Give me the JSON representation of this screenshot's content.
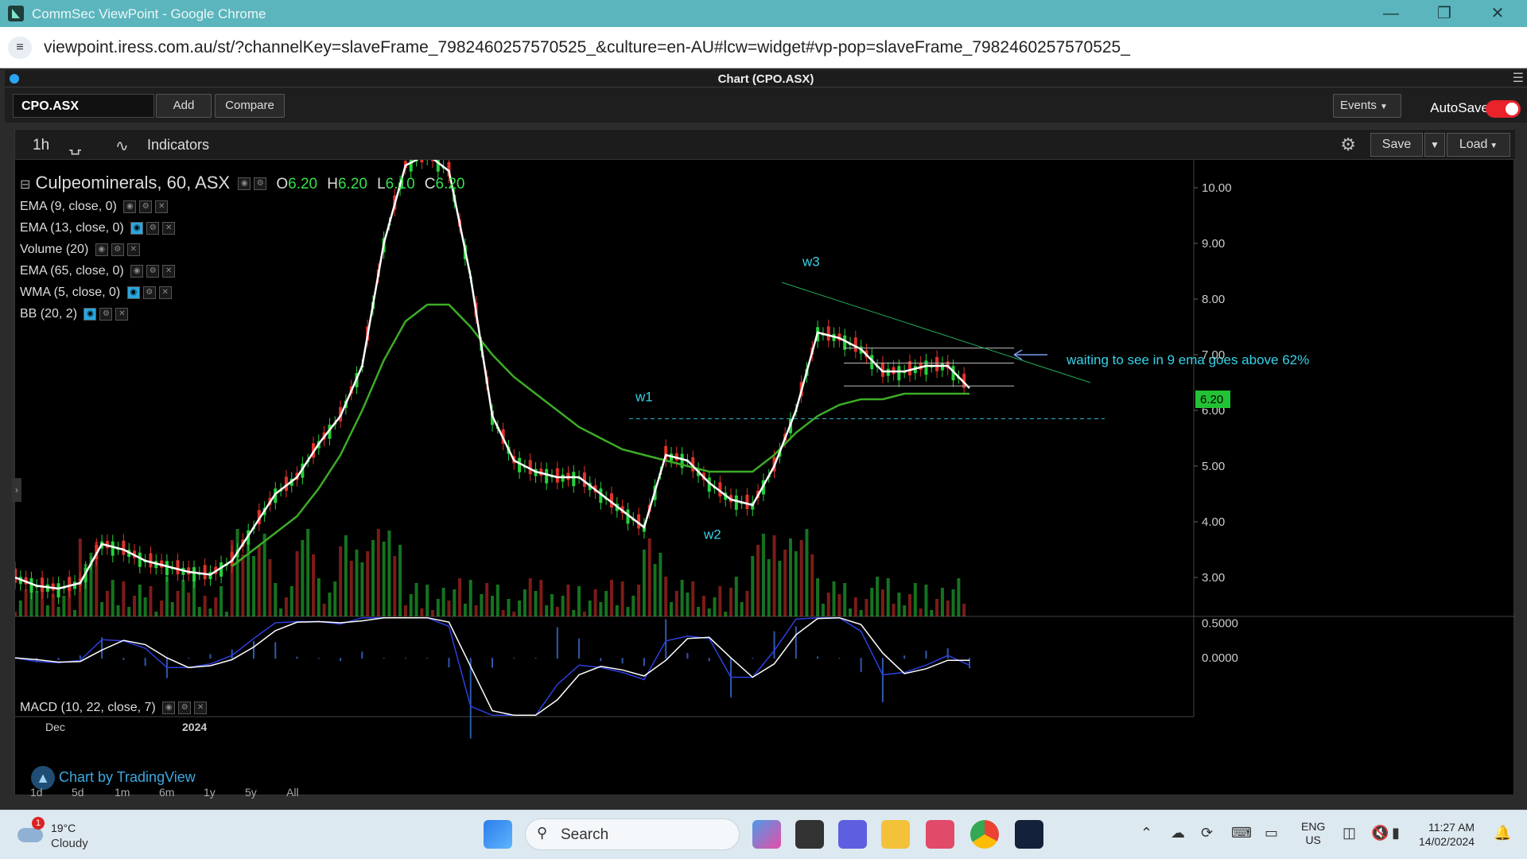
{
  "window": {
    "title": "CommSec ViewPoint - Google Chrome",
    "url": "viewpoint.iress.com.au/st/?channelKey=slaveFrame_7982460257570525_&culture=en-AU#lcw=widget#vp-pop=slaveFrame_7982460257570525_"
  },
  "panel": {
    "title": "Chart (CPO.ASX)"
  },
  "toolbar": {
    "symbol": "CPO.ASX",
    "add_label": "Add",
    "compare_label": "Compare",
    "events_label": "Events",
    "autosave_label": "AutoSave"
  },
  "chart_toolbar": {
    "timeframe": "1h",
    "indicators_label": "Indicators",
    "save_label": "Save",
    "load_label": "Load"
  },
  "legend": {
    "name": "Culpeominerals, 60, ASX",
    "o_label": "O",
    "o_value": "6.20",
    "h_label": "H",
    "h_value": "6.20",
    "l_label": "L",
    "l_value": "6.10",
    "c_label": "C",
    "c_value": "6.20",
    "indicators": [
      "EMA (9, close, 0)",
      "EMA (13, close, 0)",
      "Volume (20)",
      "EMA (65, close, 0)",
      "WMA (5, close, 0)",
      "BB (20, 2)"
    ],
    "macd": "MACD (10, 22, close, 7)"
  },
  "annotations": {
    "w1": "w1",
    "w2": "w2",
    "w3": "w3",
    "note": "waiting to see in 9 ema goes above 62%",
    "price_tag": "6.20",
    "watermark": "Chart by TradingView"
  },
  "axes": {
    "price_ticks": [
      "10.00",
      "9.00",
      "8.00",
      "7.00",
      "6.00",
      "5.00",
      "4.00",
      "3.00"
    ],
    "macd_ticks": [
      "0.5000",
      "0.0000"
    ],
    "time_labels": [
      "Dec",
      "2024"
    ]
  },
  "range_buttons": [
    "1d",
    "5d",
    "1m",
    "6m",
    "1y",
    "5y",
    "All"
  ],
  "chart_data": {
    "type": "line",
    "title": "Culpeominerals, 60, ASX",
    "ylim": [
      2.3,
      10.5
    ],
    "series": [
      {
        "name": "WMA (5, close, 0)",
        "color": "#ffffff",
        "values": [
          3.0,
          2.85,
          2.8,
          2.9,
          3.6,
          3.5,
          3.3,
          3.2,
          3.1,
          3.05,
          3.3,
          3.9,
          4.5,
          4.8,
          5.4,
          5.9,
          6.8,
          9.0,
          10.4,
          10.6,
          10.3,
          8.4,
          5.9,
          5.1,
          4.9,
          4.8,
          4.8,
          4.5,
          4.2,
          3.9,
          5.2,
          5.1,
          4.7,
          4.4,
          4.3,
          5.0,
          6.0,
          7.4,
          7.3,
          7.1,
          6.7,
          6.7,
          6.8,
          6.8,
          6.4
        ]
      },
      {
        "name": "EMA (65, close, 0)",
        "color": "#3dac26",
        "values": [
          null,
          null,
          null,
          null,
          null,
          null,
          null,
          null,
          null,
          null,
          3.2,
          3.5,
          3.8,
          4.1,
          4.6,
          5.2,
          6.0,
          6.9,
          7.6,
          7.9,
          7.9,
          7.5,
          7.0,
          6.6,
          6.3,
          6.0,
          5.7,
          5.5,
          5.3,
          5.2,
          5.1,
          5.0,
          4.9,
          4.9,
          4.9,
          5.2,
          5.6,
          5.9,
          6.1,
          6.2,
          6.2,
          6.3,
          6.3,
          6.3,
          6.3
        ]
      }
    ],
    "annotation_levels": [
      7.12,
      6.85,
      6.44,
      5.85
    ],
    "macd": {
      "ylim": [
        -0.85,
        0.6
      ]
    }
  },
  "taskbar": {
    "weather_temp": "19°C",
    "weather_desc": "Cloudy",
    "weather_badge": "1",
    "search_label": "Search",
    "lang_line1": "ENG",
    "lang_line2": "US",
    "time": "11:27 AM",
    "date": "14/02/2024"
  }
}
